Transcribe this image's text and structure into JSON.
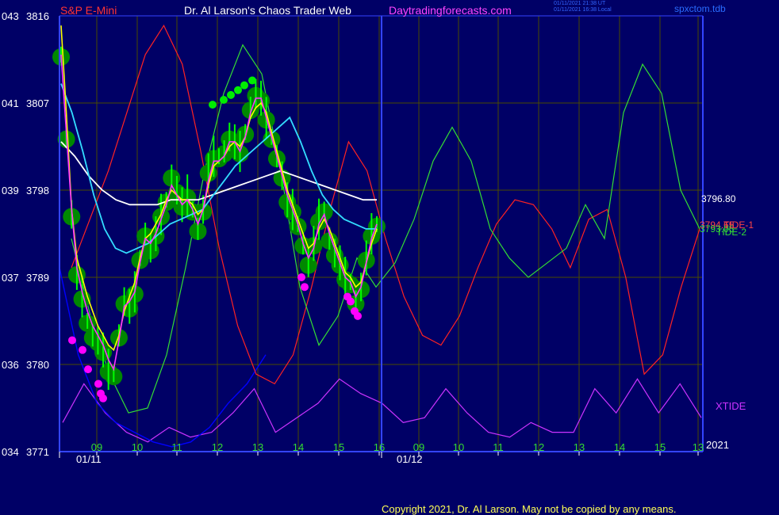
{
  "header": {
    "symbol": "S&P E-Mini",
    "title": "Dr. Al Larson's Chaos Trader Web",
    "website": "Daytradingforecasts.com",
    "stamp_utc": "01/11/2021 21:38 UT",
    "stamp_local": "01/11/2021 16:38 Local",
    "study_file": "spxctom.tdb"
  },
  "copyright": "Copyright 2021, Dr. Al Larson. May not be copied by any means.",
  "colors": {
    "background": "#000066",
    "frame": "#3344ff",
    "grid": "#4a4a00",
    "price_bars": "#00ff00",
    "price_flux": "#008800",
    "red_dots": "#ff00ff",
    "green_dots": "#00ee00",
    "magenta_line": "#ff33ff",
    "yellow_line": "#ffff00",
    "cyan_line": "#33ddff",
    "white_line": "#ffffff",
    "tide1": "#ff2222",
    "tide2": "#33dd33",
    "xtide": "#cc33ff",
    "blue_line": "#0000ff",
    "axis_left": "#ffffff",
    "axis_time": "#33dd33",
    "axis_date": "#ffffff"
  },
  "chart_data": {
    "type": "line",
    "title": "S&P E-Mini",
    "ylim": [
      3771,
      3816
    ],
    "y_ticks": [
      {
        "left": "043",
        "value": 3816
      },
      {
        "left": "041",
        "value": 3807
      },
      {
        "left": "039",
        "value": 3798
      },
      {
        "left": "037",
        "value": 3789
      },
      {
        "left": "036",
        "value": 3780
      },
      {
        "left": "034",
        "value": 3771
      }
    ],
    "hour_ticks": [
      "09",
      "10",
      "11",
      "12",
      "13",
      "14",
      "15",
      "16",
      "09",
      "10",
      "11",
      "12",
      "13",
      "14",
      "15",
      "13"
    ],
    "date_labels": [
      "01/11",
      "01/12"
    ],
    "right_values": [
      "3796.80",
      "3794.65",
      "3793.05"
    ],
    "right_labels": [
      "TIDE-1",
      "TIDE-2",
      "XTIDE",
      "2021"
    ],
    "series": [
      {
        "name": "price",
        "color": "#00ff00",
        "values": [
          3812.0,
          3803.5,
          3795.5,
          3789.5,
          3787.0,
          3784.5,
          3783.0,
          3782.5,
          3781.5,
          3779.5,
          3779.0,
          3783.0,
          3786.5,
          3786.0,
          3787.5,
          3791.0,
          3793.5,
          3792.0,
          3793.5,
          3795.5,
          3797.0,
          3799.5,
          3798.0,
          3796.5,
          3797.5,
          3796.0,
          3794.0,
          3796.0,
          3800.0,
          3801.5,
          3801.5,
          3802.0,
          3803.5,
          3803.0,
          3802.0,
          3804.0,
          3806.5,
          3808.0,
          3807.5,
          3805.5,
          3803.5,
          3801.5,
          3799.5,
          3797.0,
          3796.0,
          3794.5,
          3792.5,
          3790.5,
          3792.5,
          3795.0,
          3796.0,
          3793.0,
          3791.5,
          3790.5,
          3789.0,
          3788.5,
          3786.5,
          3788.0,
          3791.0,
          3793.5,
          3794.5
        ]
      },
      {
        "name": "magenta",
        "color": "#ff33ff",
        "values": [
          3812.0,
          3804.0,
          3796.0,
          3790.0,
          3787.5,
          3785.5,
          3784.0,
          3783.0,
          3782.0,
          3780.5,
          3779.5,
          3782.5,
          3786.0,
          3786.5,
          3787.5,
          3790.5,
          3793.0,
          3792.5,
          3793.5,
          3795.0,
          3796.5,
          3798.5,
          3797.5,
          3796.5,
          3797.0,
          3796.0,
          3794.5,
          3796.0,
          3799.0,
          3801.0,
          3801.0,
          3801.5,
          3803.0,
          3803.0,
          3802.0,
          3803.5,
          3806.0,
          3807.5,
          3807.5,
          3805.5,
          3803.5,
          3801.5,
          3799.5,
          3797.5,
          3796.0,
          3794.5,
          3792.5,
          3791.0,
          3792.0,
          3794.5,
          3795.5,
          3793.5,
          3792.0,
          3790.5,
          3789.0,
          3788.5,
          3787.0,
          3788.0,
          3790.5,
          3793.0,
          3794.5
        ]
      },
      {
        "name": "yellow",
        "color": "#ffff00",
        "values": [
          3815.0,
          3806.0,
          3796.0,
          3791.0,
          3789.0,
          3787.0,
          3785.5,
          3784.0,
          3783.0,
          3782.0,
          3781.5,
          3783.0,
          3785.5,
          3787.0,
          3788.5,
          3791.0,
          3793.0,
          3793.5,
          3794.5,
          3795.5,
          3797.0,
          3798.0,
          3797.5,
          3797.0,
          3797.0,
          3796.5,
          3795.5,
          3796.0,
          3798.5,
          3800.5,
          3801.0,
          3801.5,
          3802.5,
          3803.0,
          3802.5,
          3803.5,
          3805.5,
          3806.5,
          3807.0,
          3806.0,
          3804.0,
          3802.0,
          3800.0,
          3798.0,
          3796.5,
          3795.0,
          3793.5,
          3792.0,
          3792.5,
          3794.0,
          3795.0,
          3794.0,
          3792.5,
          3791.0,
          3789.5,
          3789.0,
          3788.0,
          3788.5,
          3790.5,
          3792.5,
          3794.0
        ]
      },
      {
        "name": "cyan",
        "color": "#33ddff",
        "values": [
          3809.0,
          3806.0,
          3802.0,
          3797.5,
          3794.0,
          3792.0,
          3791.5,
          3792.0,
          3792.5,
          3793.5,
          3794.5,
          3795.0,
          3795.5,
          3796.0,
          3797.5,
          3799.0,
          3800.5,
          3801.5,
          3802.5,
          3803.5,
          3804.5,
          3805.5,
          3803.0,
          3800.0,
          3797.5,
          3796.0,
          3795.0,
          3794.5,
          3794.0,
          3794.0
        ]
      },
      {
        "name": "white",
        "color": "#ffffff",
        "values": [
          3803.0,
          3801.5,
          3799.5,
          3798.0,
          3797.0,
          3796.5,
          3796.5,
          3796.5,
          3797.0,
          3797.0,
          3797.0,
          3797.5,
          3798.0,
          3798.5,
          3799.0,
          3799.5,
          3800.0,
          3799.5,
          3799.0,
          3798.5,
          3798.0,
          3797.5,
          3797.0,
          3797.0
        ]
      },
      {
        "name": "TIDE-1",
        "color": "#ff2222",
        "values": [
          3790.0,
          3795.0,
          3800.0,
          3806.0,
          3812.0,
          3815.0,
          3811.0,
          3802.0,
          3792.0,
          3784.0,
          3779.0,
          3778.0,
          3781.0,
          3788.0,
          3796.0,
          3803.0,
          3800.0,
          3793.0,
          3787.0,
          3783.0,
          3782.0,
          3785.0,
          3790.0,
          3794.5,
          3797.0,
          3796.5,
          3794.0,
          3790.0,
          3795.0,
          3796.0,
          3789.0,
          3779.0,
          3781.0,
          3788.0,
          3794.0
        ]
      },
      {
        "name": "TIDE-2",
        "color": "#33dd33",
        "values": [
          3793.0,
          3785.0,
          3779.0,
          3775.0,
          3775.5,
          3781.0,
          3790.0,
          3800.0,
          3808.0,
          3813.0,
          3810.0,
          3800.0,
          3788.0,
          3782.0,
          3785.0,
          3791.0,
          3788.0,
          3790.5,
          3795.0,
          3801.0,
          3804.5,
          3801.0,
          3794.0,
          3791.0,
          3789.0,
          3790.5,
          3792.0,
          3796.5,
          3793.0,
          3806.0,
          3811.0,
          3808.0,
          3798.0,
          3794.0
        ]
      },
      {
        "name": "XTIDE",
        "color": "#cc33ff",
        "values": [
          3774.0,
          3778.0,
          3775.0,
          3773.0,
          3772.0,
          3773.5,
          3772.5,
          3773.0,
          3775.0,
          3777.5,
          3773.0,
          3774.5,
          3776.0,
          3778.5,
          3777.0,
          3776.0,
          3774.0,
          3774.5,
          3777.5,
          3775.0,
          3773.0,
          3772.5,
          3774.0,
          3773.0,
          3773.0,
          3777.5,
          3775.0,
          3778.5,
          3775.0,
          3778.0,
          3774.5
        ]
      },
      {
        "name": "blue",
        "color": "#0000ff",
        "values": [
          3790.0,
          3781.0,
          3776.0,
          3774.0,
          3773.0,
          3772.0,
          3771.5,
          3772.0,
          3773.5,
          3776.0,
          3778.0,
          3781.0
        ]
      }
    ],
    "red_dots": [
      3782.5,
      3781.5,
      3779.5,
      3778.0,
      3777.0,
      3776.5,
      3789.0,
      3788.0,
      3787.0,
      3786.5,
      3785.5,
      3785.0
    ],
    "green_dots": [
      3806.5,
      3807.0,
      3807.5,
      3808.0,
      3808.5,
      3809.0
    ]
  }
}
